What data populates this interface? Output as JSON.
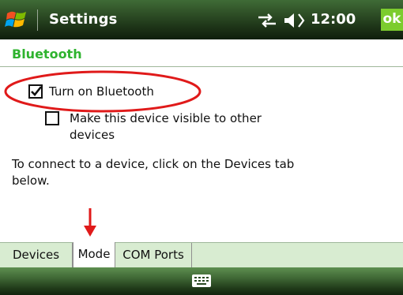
{
  "titlebar": {
    "app_title": "Settings",
    "clock": "12:00",
    "ok_label": "ok",
    "icons": [
      "windows-start-icon",
      "connectivity-icon",
      "volume-icon"
    ]
  },
  "page": {
    "section_title": "Bluetooth"
  },
  "options": {
    "bluetooth_on": {
      "label": "Turn on Bluetooth",
      "checked": true
    },
    "visible": {
      "label": "Make this device visible to other devices",
      "checked": false
    }
  },
  "help_text": "To connect to a device, click on the Devices tab below.",
  "tabs": [
    {
      "label": "Devices",
      "active": false
    },
    {
      "label": "Mode",
      "active": true
    },
    {
      "label": "COM Ports",
      "active": false
    }
  ],
  "menubar": {
    "icon": "keyboard-icon"
  },
  "colors": {
    "accent_green": "#2fb32f",
    "ok_button": "#7ccc2e",
    "tab_strip": "#d8ecd1",
    "annotation_red": "#e01a1a"
  }
}
